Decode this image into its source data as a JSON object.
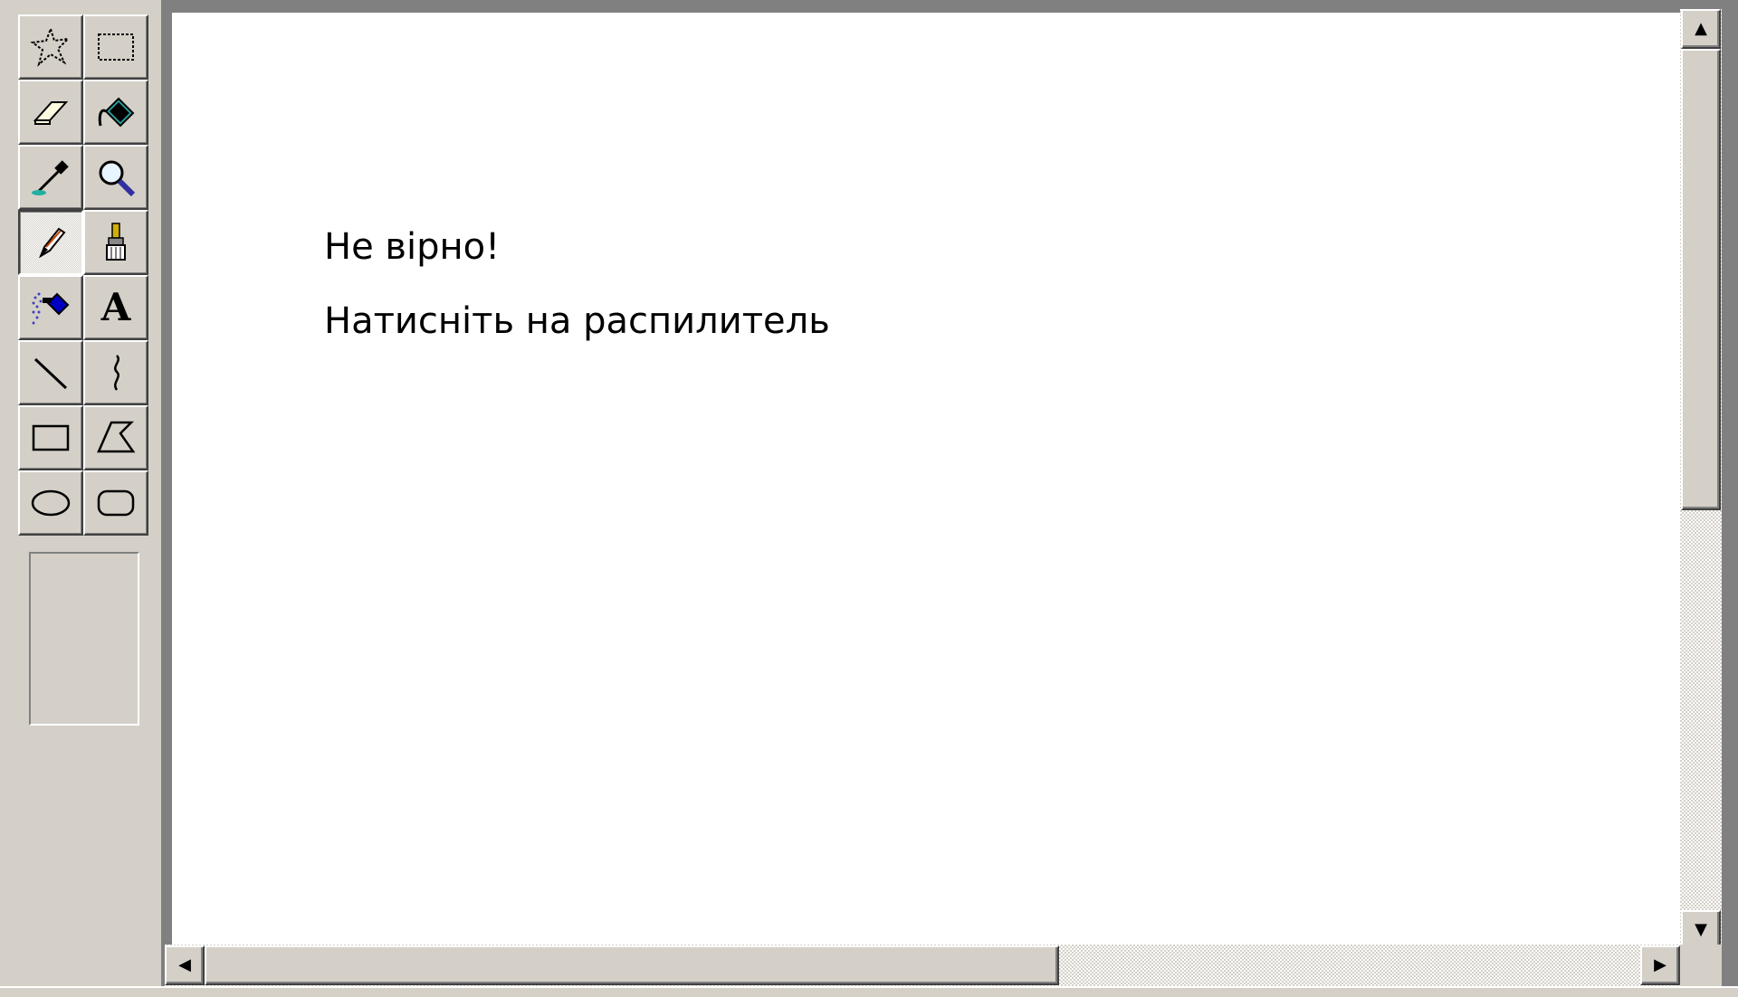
{
  "canvas": {
    "line1": "Не вірно!",
    "line2": "Натисніть на распилитель"
  },
  "toolbox": {
    "tools": [
      {
        "name": "free-form-select",
        "icon": "free-select-icon"
      },
      {
        "name": "select",
        "icon": "rect-select-icon"
      },
      {
        "name": "eraser",
        "icon": "eraser-icon"
      },
      {
        "name": "fill-with-color",
        "icon": "paint-bucket-icon"
      },
      {
        "name": "pick-color",
        "icon": "eyedropper-icon"
      },
      {
        "name": "magnifier",
        "icon": "magnifier-icon"
      },
      {
        "name": "pencil",
        "icon": "pencil-icon",
        "active": true
      },
      {
        "name": "brush",
        "icon": "brush-icon"
      },
      {
        "name": "airbrush",
        "icon": "airbrush-icon"
      },
      {
        "name": "text",
        "icon": "text-icon",
        "glyph": "A"
      },
      {
        "name": "line",
        "icon": "line-icon"
      },
      {
        "name": "curve",
        "icon": "curve-icon"
      },
      {
        "name": "rectangle",
        "icon": "rectangle-icon"
      },
      {
        "name": "polygon",
        "icon": "polygon-icon"
      },
      {
        "name": "ellipse",
        "icon": "ellipse-icon"
      },
      {
        "name": "rounded-rectangle",
        "icon": "rounded-rectangle-icon"
      }
    ]
  },
  "scrollbars": {
    "vertical": {
      "up_arrow": "▲",
      "down_arrow": "▼"
    },
    "horizontal": {
      "left_arrow": "◀",
      "right_arrow": "▶"
    }
  },
  "colors": {
    "face": "#d4d0c8",
    "canvas": "#ffffff",
    "shadow": "#808080"
  }
}
